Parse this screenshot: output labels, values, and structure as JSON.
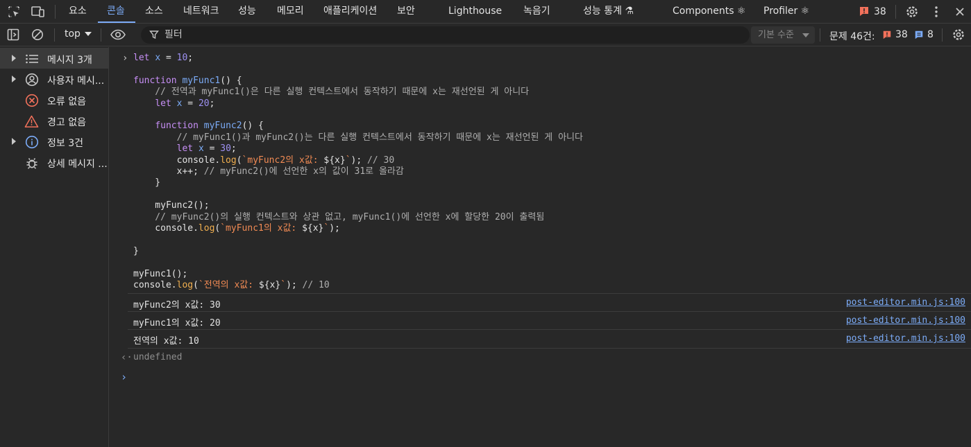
{
  "tabs": [
    {
      "label": "요소"
    },
    {
      "label": "콘솔"
    },
    {
      "label": "소스"
    },
    {
      "label": "네트워크"
    },
    {
      "label": "성능"
    },
    {
      "label": "메모리"
    },
    {
      "label": "애플리케이션"
    },
    {
      "label": "보안"
    },
    {
      "label": "Lighthouse"
    },
    {
      "label": "녹음기"
    },
    {
      "label": "성능 통계 ⚗"
    },
    {
      "label": "Components ⚛"
    },
    {
      "label": "Profiler ⚛"
    }
  ],
  "active_tab": "콘솔",
  "issue_badge_count": "38",
  "toolbar": {
    "context": "top",
    "filter_placeholder": "필터",
    "levels": "기본 수준",
    "issues_label": "문제 46건:",
    "issues_errors": "38",
    "issues_info": "8"
  },
  "sidebar": [
    {
      "label": "메시지 3개",
      "icon": "list-icon",
      "expandable": true
    },
    {
      "label": "사용자 메시...",
      "icon": "user-icon",
      "expandable": true
    },
    {
      "label": "오류 없음",
      "icon": "error-icon",
      "expandable": false
    },
    {
      "label": "경고 없음",
      "icon": "warning-icon",
      "expandable": false
    },
    {
      "label": "정보 3건",
      "icon": "info-icon",
      "expandable": true
    },
    {
      "label": "상세 메시지 ...",
      "icon": "bug-icon",
      "expandable": false
    }
  ],
  "console": {
    "code_lines": [
      "let x = 10;",
      "",
      "function myFunc1() {",
      "    // 전역과 myFunc1()은 다른 실행 컨텍스트에서 동작하기 때문에 x는 재선언된 게 아니다",
      "    let x = 20;",
      "",
      "    function myFunc2() {",
      "        // myFunc1()과 myFunc2()는 다른 실행 컨텍스트에서 동작하기 때문에 x는 재선언된 게 아니다",
      "        let x = 30;",
      "        console.log(`myFunc2의 x값: ${x}`); // 30",
      "        x++; // myFunc2()에 선언한 x의 값이 31로 올라감",
      "    }",
      "",
      "    myFunc2();",
      "    // myFunc2()의 실행 컨텍스트와 상관 없고, myFunc1()에 선언한 x에 할당한 20이 출력됨",
      "    console.log(`myFunc1의 x값: ${x}`);",
      "",
      "}",
      "",
      "myFunc1();",
      "console.log(`전역의 x값: ${x}`); // 10"
    ],
    "logs": [
      {
        "text": "myFunc2의 x값: 30",
        "source": "post-editor.min.js:100"
      },
      {
        "text": "myFunc1의 x값: 20",
        "source": "post-editor.min.js:100"
      },
      {
        "text": "전역의 x값: 10",
        "source": "post-editor.min.js:100"
      }
    ],
    "result": "undefined"
  },
  "colors": {
    "accent": "#7cacf8",
    "keyword": "#c78ff6",
    "string": "#f28b54",
    "number": "#9e91f2",
    "error": "#f2715b"
  }
}
